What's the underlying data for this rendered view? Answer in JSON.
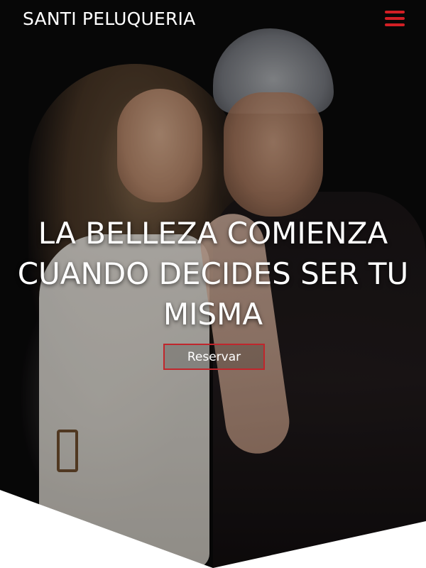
{
  "nav": {
    "brand": "SANTI PELUQUERIA",
    "menu_icon": "hamburger-menu-icon",
    "menu_color": "#d21f25"
  },
  "hero": {
    "headline": "LA BELLEZA COMIENZA CUANDO DECIDES SER TU MISMA",
    "cta_label": "Reservar",
    "cta_border_color": "#c0262c"
  }
}
